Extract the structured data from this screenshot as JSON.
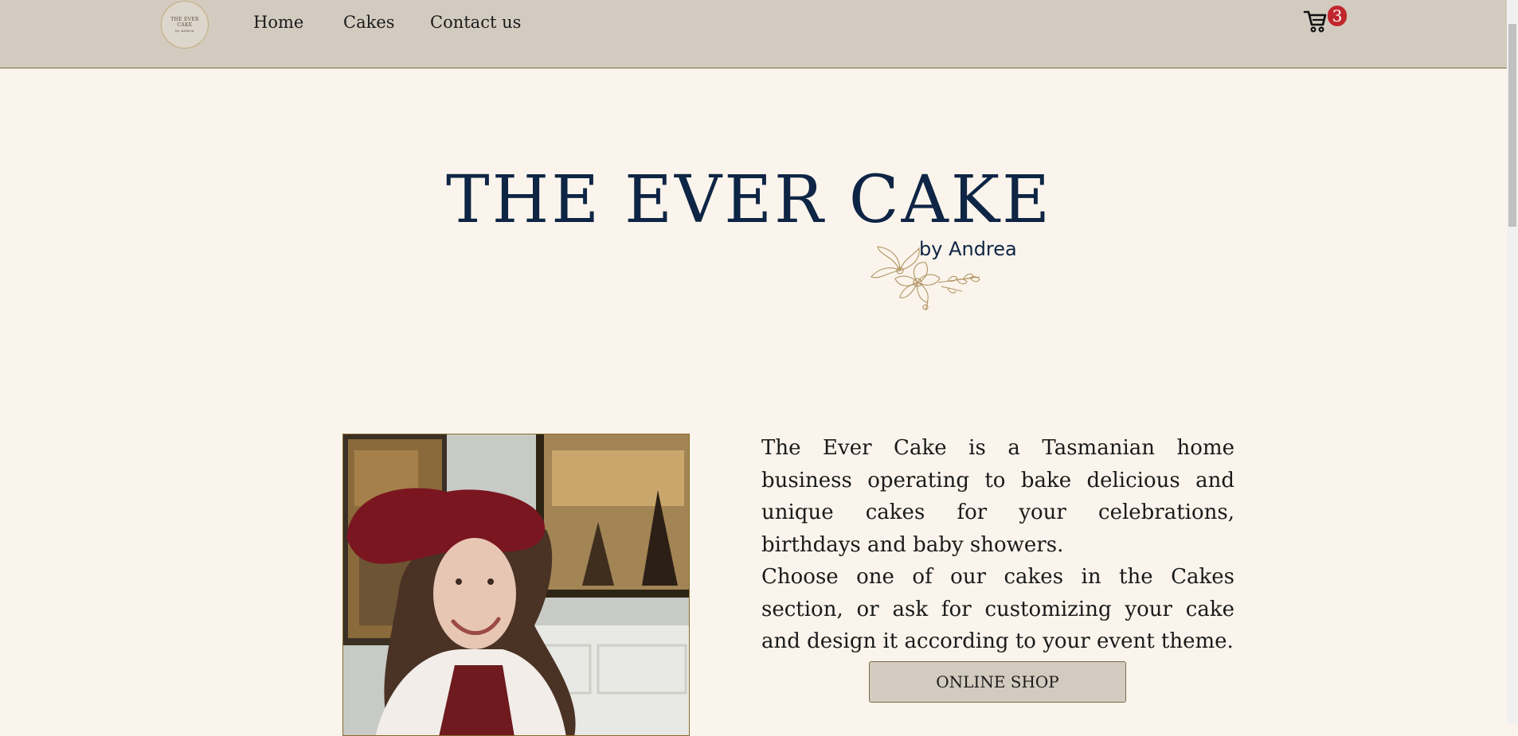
{
  "header": {
    "logo_text_line1": "THE EVER",
    "logo_text_line2": "CAKE",
    "logo_text_line3": "by Andrea",
    "nav": [
      {
        "label": "Home"
      },
      {
        "label": "Cakes"
      },
      {
        "label": "Contact us"
      }
    ],
    "cart_count": "3"
  },
  "hero": {
    "title": "THE EVER CAKE",
    "subtitle": "by Andrea"
  },
  "about": {
    "paragraph1": "The Ever Cake is a Tasmanian home business operating to bake delicious and unique cakes for your celebrations, birthdays and baby showers.",
    "paragraph2": "Choose one of our cakes in the Cakes section, or ask for customizing your cake and design it according to your event theme.",
    "button_label": "ONLINE SHOP"
  },
  "colors": {
    "header_bg": "#d3cbbf",
    "page_bg": "#faf4ec",
    "title_navy": "#0e2545",
    "badge_red": "#c0272d",
    "gold": "#b09360"
  }
}
